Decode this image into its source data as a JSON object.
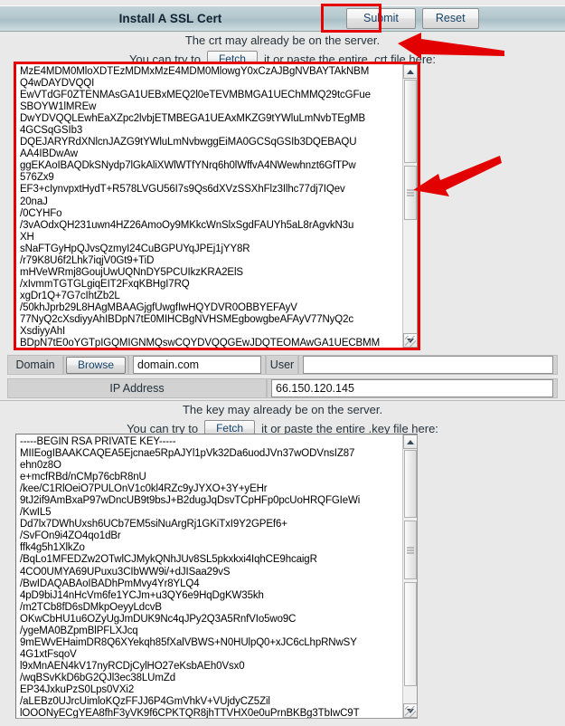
{
  "window": {
    "title": "Install A SSL Cert",
    "submit_label": "Submit",
    "reset_label": "Reset"
  },
  "crt_section": {
    "notice_line1": "The crt may already be on the server.",
    "notice_prefix": "You can try to",
    "fetch_label": "Fetch",
    "notice_suffix": "it or paste the entire .crt file here:",
    "textarea_value": "MzE4MDM0MloXDTEzMDMxMzE4MDM0MlowgY0xCzAJBgNVBAYTAkNBM\nQ4wDAYDVQQI\nEwVTdGF0ZTENMAsGA1UEBxMEQ2l0eTEVMBMGA1UEChMMQ29tcGFue\nSBOYW1lMREw\nDwYDVQQLEwhEaXZpc2lvbjETMBEGA1UEAxMKZG9tYWluLmNvbTEgMB\n4GCSqGSIb3\nDQEJARYRdXNlcnJAZG9tYWluLmNvbwggEiMA0GCSqGSIb3DQEBAQU\nAA4IBDwAw\nggEKAoIBAQDkSNydp7lGkAliXWlWTfYNrq6h0lWffvA4NWewhnzt6GfTPw\n576Zx9\nEF3+cIynvpxtHydT+R578LVGU56I7s9Qs6dXVzSSXhFlz3Ilhc77dj7IQev\n20naJ\n/0CYHFo\n/3vAOdxQH231uwn4HZ26AmoOy9MKkcWnSlxSgdFAUYh5aL8rAgvkN3u\nXH\nsNaFTGyHpQJvsQzmyI24CuBGPUYqJPEj1jYY8R\n/r79K8U6f2Lhk7iqjV0Gt9+TiD\nmHVeWRmj8GoujUwUQNnDY5PCUIkzKRA2ElS\n/xIvmmTGTGLgiqEIT2FxqKBHgI7RQ\nxgDr1Q+7G7cIhtZb2L\n/50khJprb29L8HAgMBAAGjgfUwgfIwHQYDVR0OBBYEFAyV\n77NyQ2cXsdiyyAhIBDpN7tE0MIHCBgNVHSMEgbowgbeAFAyV77NyQ2c\nXsdiyyAhI\nBDpN7tE0oYGTpIGQMIGNMQswCQYDVQQGEwJDQTEOMAwGA1UECBMM",
    "scroll_thumb_top_pct": 46
  },
  "domain_row": {
    "domain_label": "Domain",
    "browse_label": "Browse",
    "domain_value": "domain.com",
    "user_label": "User",
    "user_value": ""
  },
  "ip_row": {
    "ip_label": "IP Address",
    "ip_value": "66.150.120.145"
  },
  "key_section": {
    "notice_line1": "The key may already be on the server.",
    "notice_prefix": "You can try to",
    "fetch_label": "Fetch",
    "notice_suffix": "it or paste the entire .key file here:",
    "textarea_value": "-----BEGIN RSA PRIVATE KEY-----\nMIIEogIBAAKCAQEA5Ejcnae5RpAJYl1pVk32Da6uodJVn37wODVnsIZ87\nehn0z8O\ne+mcfRBd/nCMp76cbR8nU\n/kee/C1RlOeiO7PULOnV1c0kl4RZc9yJYXO+3Y+yEHr\n9tJ2if9AmBxaP97wDncUB9t9bsJ+B2dugJqDsvTCpHFp0pcUoHRQFGIeWi\n/KwIL5\nDd7lx7DWhUxsh6UCb7EM5siNuArgRj1GKiTxI9Y2GPEf6+\n/SvFOn9i4ZO4qo1dBr\nffk4g5h1XlkZo\n/BqLo1MFEDZw2OTwlCJMykQNhJUv8SL5pkxkxi4IqhCE9hcaigR\n4CO0UMYA69UPuxu3CIbWW9i/+dJISaa29vS\n/BwIDAQABAoIBADhPmMvy4Yr8YLQ4\n4pD9biJ14nHcVm6fe1YCJm+u3QY6e9HqDgKW35kh\n/m2TCb8fD6sDMkpOeyyLdcvB\nOKwCbHU1u6OZyUgJmDUK9Nc4qJPy2Q3A5RnfVIo5wo9C\n/ygeMA0BZpmBlPFLXJcq\n9mEWvEHaimDR8Q6XYekqh85fXalVBWS+N0HUlpQ0+xJC6cLhpRNwSY\n4G1xtFsqoV\nl9xMnAEN4kV17nyRCDjCylHO27eKsbAEh0Vsx0\n/wqBSvKkD6bG2QJl3ec38LUmZd\nEP34JxkuPzS0Lps0VXi2\n/aLEBz0UJrcUimloKQzFFJJ6P4GmVhkV+VUjdyCZ5Zil\nlOOONyECgYEA8fhF3yVK9f6CPKTQR8jhTTVHX0e0uPrnBKBg3TbIwC9T",
    "scroll_thumb_top_pct": 52
  },
  "annotations": {
    "submit_highlight": "red-box-around-submit",
    "crt_highlight": "red-box-around-crt-textarea",
    "arrow_top": "red-arrow-pointing-to-submit",
    "arrow_mid": "red-arrow-pointing-to-crt-textarea"
  }
}
